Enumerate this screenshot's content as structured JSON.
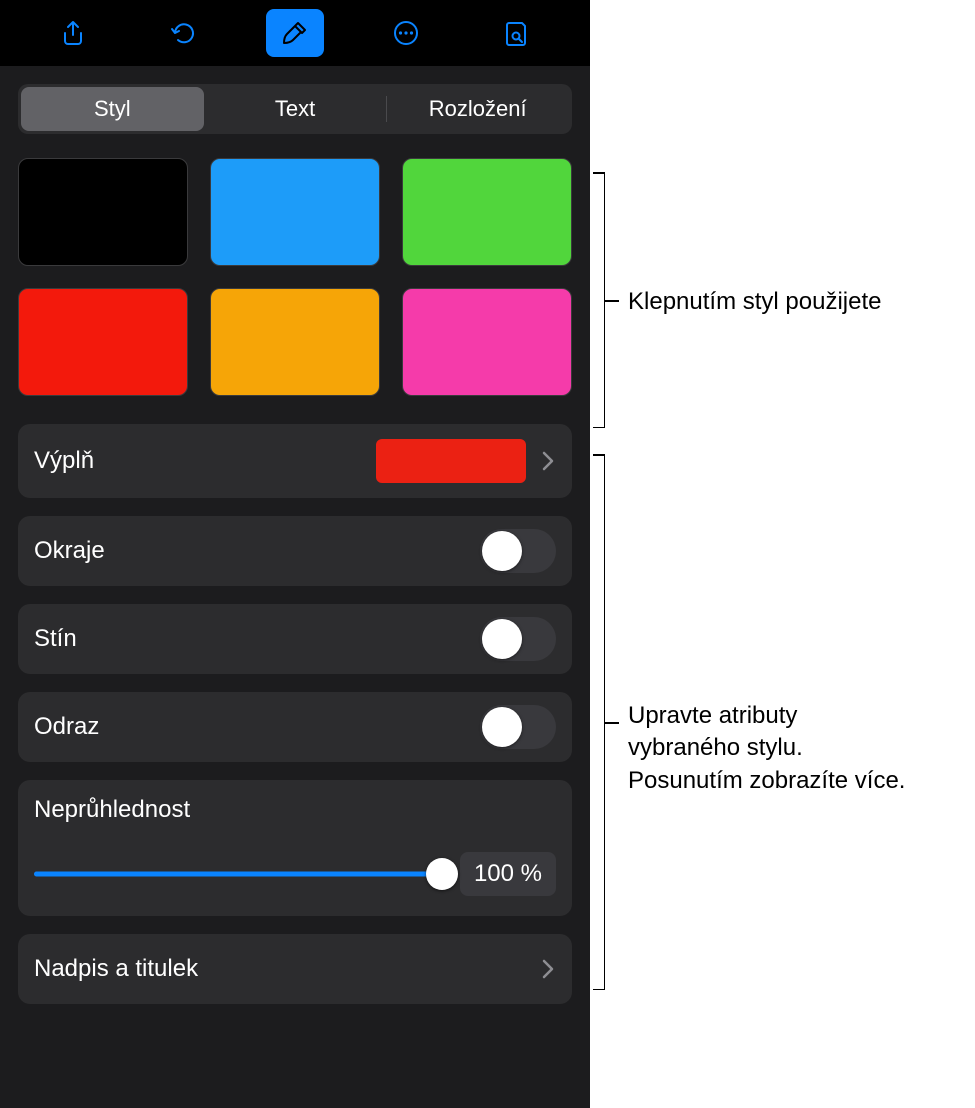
{
  "toolbar": {
    "icons": [
      "share-icon",
      "undo-icon",
      "format-brush-icon",
      "more-circle-icon",
      "presenter-notes-icon"
    ],
    "active_index": 2
  },
  "tabs": {
    "items": [
      "Styl",
      "Text",
      "Rozložení"
    ],
    "active_index": 0
  },
  "swatches": [
    "#000000",
    "#1d9cf9",
    "#51d63c",
    "#f3190c",
    "#f6a507",
    "#f53baa"
  ],
  "fill": {
    "label": "Výplň",
    "color": "#eb2113"
  },
  "border": {
    "label": "Okraje",
    "on": false
  },
  "shadow": {
    "label": "Stín",
    "on": false
  },
  "reflection": {
    "label": "Odraz",
    "on": false
  },
  "opacity": {
    "label": "Neprůhlednost",
    "value_text": "100 %",
    "value_pct": 100
  },
  "title_caption": {
    "label": "Nadpis a titulek"
  },
  "callouts": {
    "top": "Klepnutím styl použijete",
    "bottom_line1": "Upravte atributy",
    "bottom_line2": "vybraného stylu.",
    "bottom_line3": "Posunutím zobrazíte více."
  }
}
